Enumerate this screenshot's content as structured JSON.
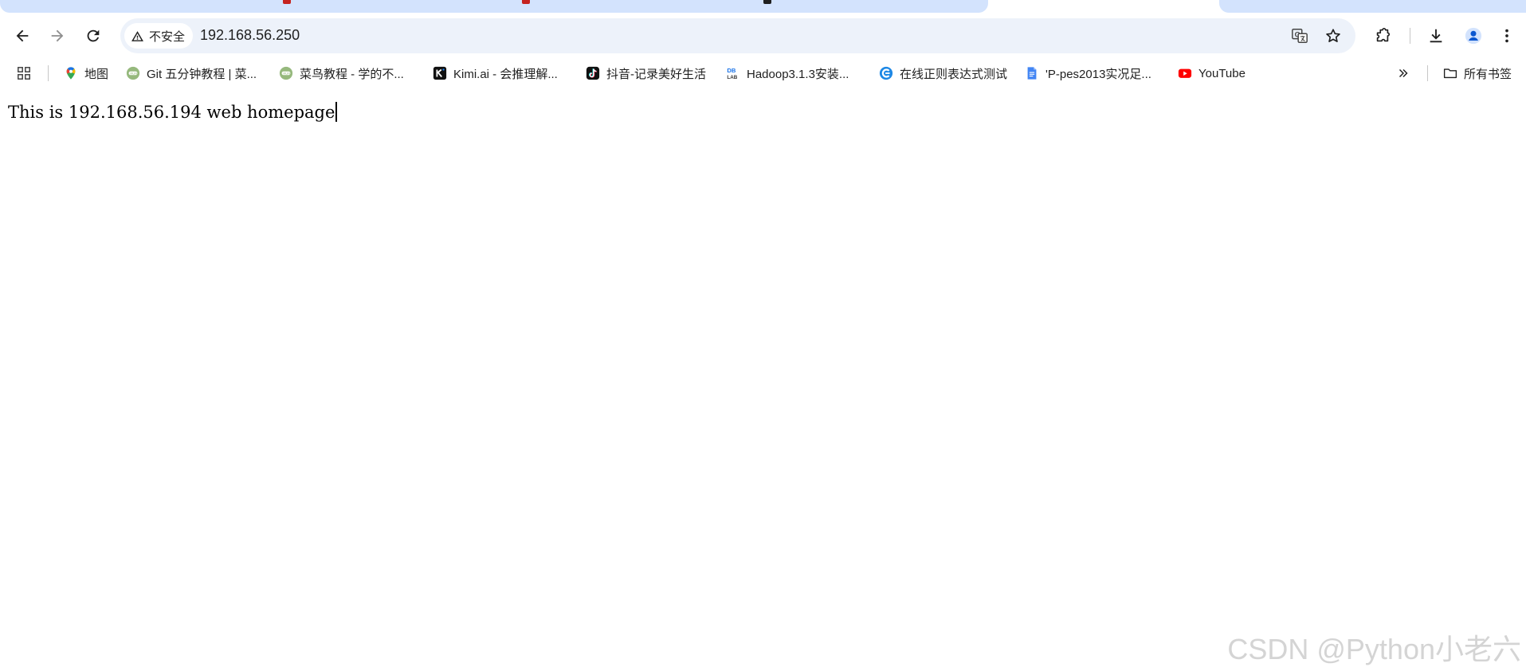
{
  "toolbar": {
    "security_label": "不安全",
    "url": "192.168.56.250"
  },
  "bookmarks": {
    "items": [
      {
        "label": "地图",
        "icon": "google-maps-icon"
      },
      {
        "label": "Git 五分钟教程 | 菜...",
        "icon": "runoob-icon"
      },
      {
        "label": "菜鸟教程 - 学的不...",
        "icon": "runoob-icon"
      },
      {
        "label": "Kimi.ai - 会推理解...",
        "icon": "kimi-icon"
      },
      {
        "label": "抖音-记录美好生活",
        "icon": "douyin-icon"
      },
      {
        "label": "Hadoop3.1.3安装...",
        "icon": "dblab-icon"
      },
      {
        "label": "在线正则表达式测试",
        "icon": "regex-icon"
      },
      {
        "label": "'P-pes2013实况足...",
        "icon": "doc-icon"
      },
      {
        "label": "YouTube",
        "icon": "youtube-icon"
      }
    ],
    "all_bookmarks_label": "所有书签"
  },
  "page": {
    "body_text": "This is 192.168.56.194 web homepage"
  },
  "watermark": "CSDN @Python小老六",
  "colors": {
    "tab_strip": "#d3e3fd",
    "omnibox": "#edf2fa",
    "text": "#1f1f1f",
    "youtube_red": "#ff0000"
  }
}
